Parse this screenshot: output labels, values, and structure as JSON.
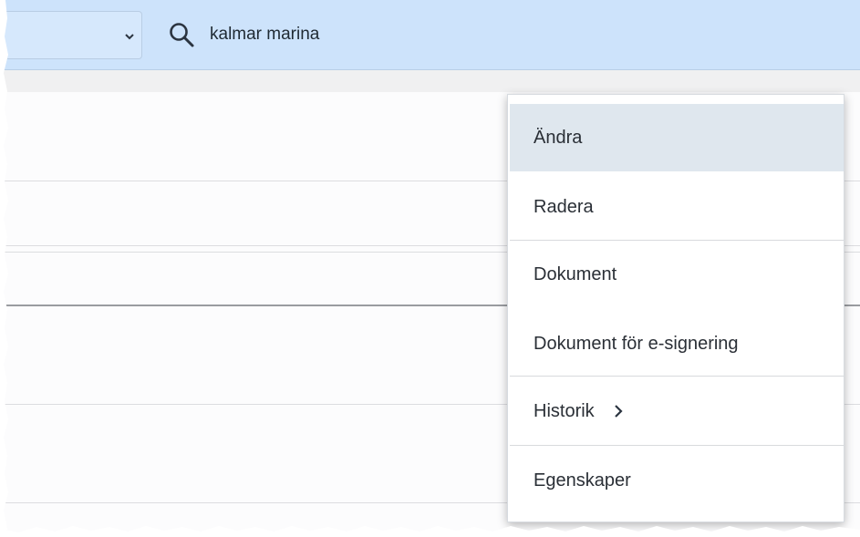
{
  "topbar": {
    "search_value": "kalmar marina"
  },
  "icons": {
    "dropdown": "chevron-down-icon",
    "search": "search-icon",
    "submenu": "chevron-right-icon"
  },
  "colors": {
    "topbar_bg": "#cde3fb",
    "menu_active_bg": "#dfe7ee"
  },
  "context_menu": {
    "items": [
      {
        "label": "Ändra"
      },
      {
        "label": "Radera"
      },
      {
        "label": "Dokument"
      },
      {
        "label": "Dokument för e-signering"
      },
      {
        "label": "Historik"
      },
      {
        "label": "Egenskaper"
      }
    ]
  }
}
